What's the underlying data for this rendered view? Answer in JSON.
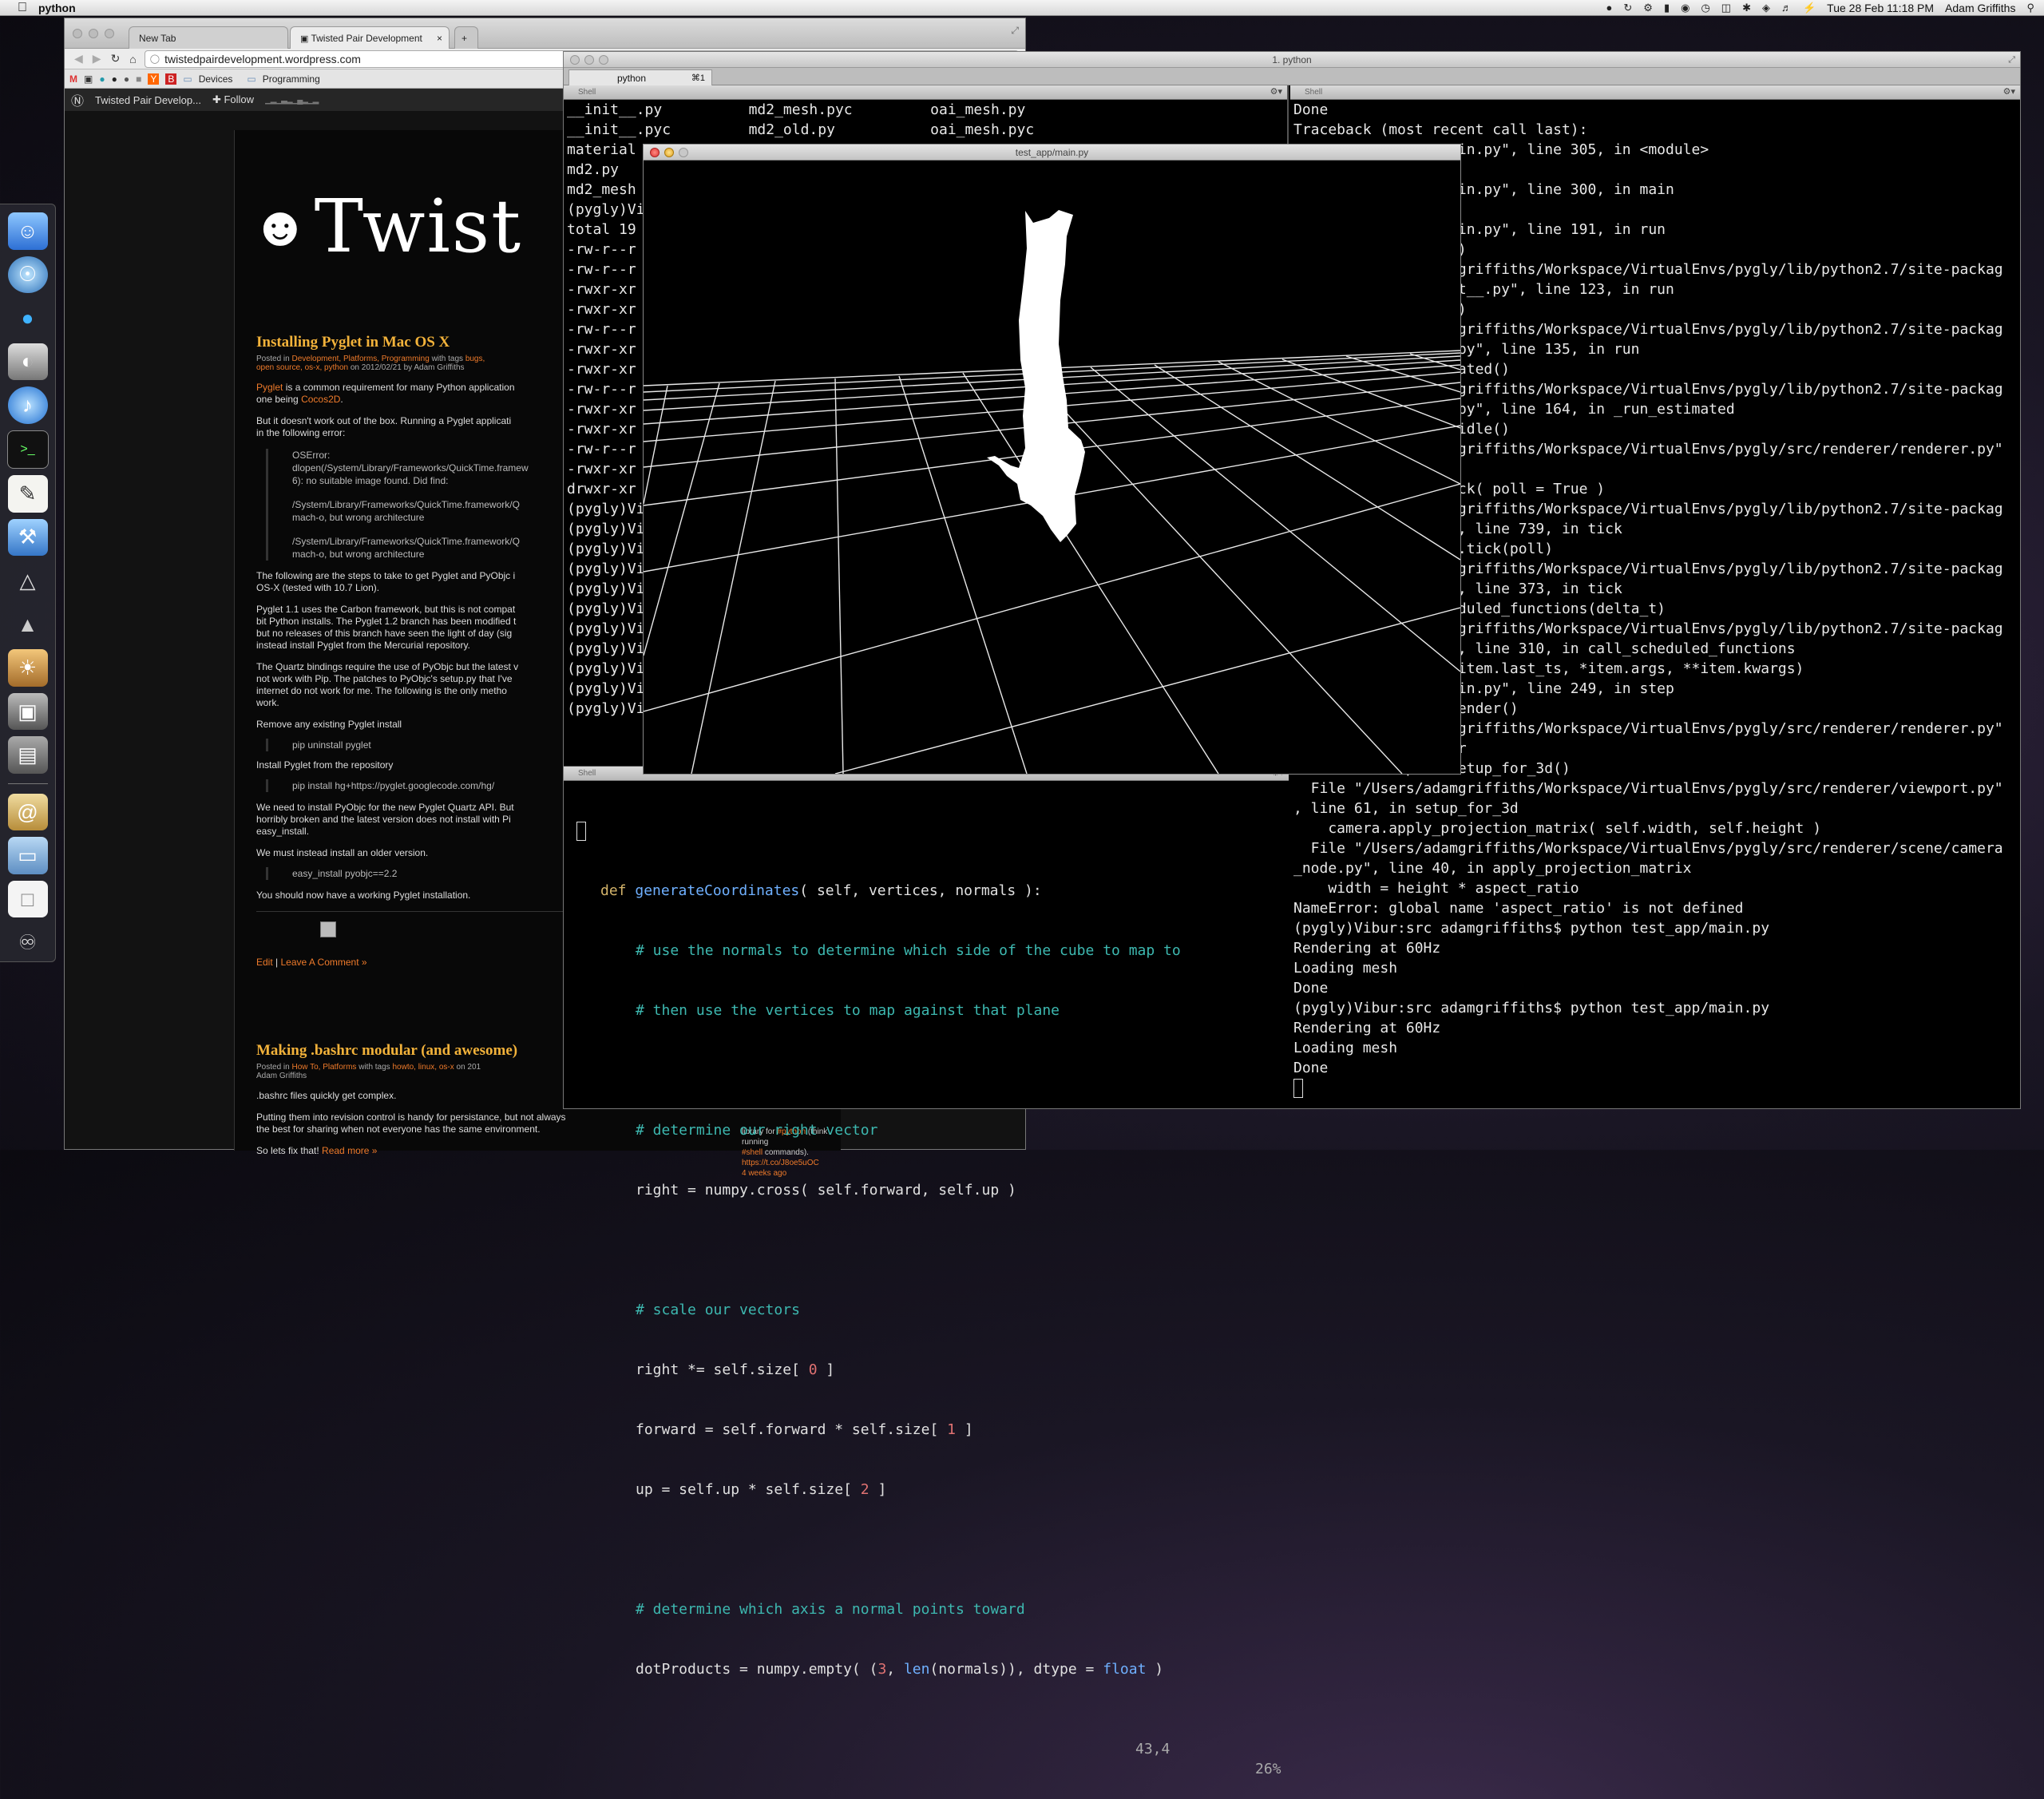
{
  "menubar": {
    "app_name": "python",
    "clock": "Tue 28 Feb  11:18 PM",
    "user": "Adam Griffiths"
  },
  "dock": {
    "icons": [
      "finder-icon",
      "browser-icon",
      "adium-icon",
      "disk-utility-icon",
      "itunes-icon",
      "terminal-icon",
      "textedit-icon",
      "xcode-icon",
      "inkscape-icon",
      "flip-icon",
      "iphoto-icon",
      "preview-icon",
      "console-icon",
      "address-book-icon",
      "folder-icon",
      "document-icon",
      "trash-icon"
    ]
  },
  "browser": {
    "tabs": [
      {
        "label": "New Tab"
      },
      {
        "label": "Twisted Pair Development"
      }
    ],
    "url": "twistedpairdevelopment.wordpress.com",
    "bookmarks": [
      "Devices",
      "Programming"
    ],
    "wp_bar": {
      "site_name": "Twisted Pair Develop...",
      "follow_label": "Follow"
    },
    "blog": {
      "logo_text": "Twist",
      "post1": {
        "title": "Installing Pyglet in Mac OS X",
        "meta_prefix": "Posted in",
        "meta_cats": "Development, Platforms, Programming",
        "meta_mid": "with tags",
        "meta_tags_1": "bugs,",
        "meta_tags_2": "open source, os-x, python",
        "meta_date": "on 2012/02/21 by Adam Griffiths",
        "p1_link": "Pyglet",
        "p1_text": " is a common requirement for many Python application",
        "p1_text2": "one being ",
        "p1_link2": "Cocos2D",
        "p1_end": ".",
        "p2": "But it doesn't work out of the box. Running a Pyglet applicati",
        "p2b": "in the following error:",
        "err1": "OSError:",
        "err2": "dlopen(/System/Library/Frameworks/QuickTime.framew",
        "err3": "6): no suitable image found.  Did find:",
        "err4": "/System/Library/Frameworks/QuickTime.framework/Q",
        "err5": "mach-o, but wrong architecture",
        "err6": "/System/Library/Frameworks/QuickTime.framework/Q",
        "err7": "mach-o, but wrong architecture",
        "p3": "The following are the steps to take to get Pyglet and PyObjc i",
        "p3b": "OS-X (tested with 10.7 Lion).",
        "p4": "Pyglet 1.1 uses the Carbon framework, but this is not compat",
        "p4b": "bit Python installs. The Pyglet 1.2 branch has been modified t",
        "p4c": "but no releases of this branch have seen the light of day (sig",
        "p4d": "instead install Pyglet from the Mercurial repository.",
        "p5": "The Quartz bindings require the use of PyObjc but the latest v",
        "p5b": "not work with Pip. The patches to PyObjc's setup.py that I've",
        "p5c": "internet do not work for me. The following is the only metho",
        "p5d": "work.",
        "p6": "Remove any existing Pyglet install",
        "c1": "pip uninstall pyglet",
        "p7": "Install Pyglet from the repository",
        "c2": "pip install hg+https://pyglet.googlecode.com/hg/",
        "p8": "We need to install PyObjc for the new Pyglet Quartz API. But",
        "p8b": "horribly broken and the latest version does not install with Pi",
        "p8c": "easy_install.",
        "p9": "We must instead install an older version.",
        "c3": "easy_install pyobjc==2.2",
        "p10": "You should now have a working Pyglet installation.",
        "edit": "Edit",
        "sep": " | ",
        "comment": "Leave A Comment »"
      },
      "post2": {
        "title": "Making .bashrc modular (and awesome)",
        "meta_prefix": "Posted in",
        "meta_cats": "How To, Platforms",
        "meta_mid": "with tags",
        "meta_tags": "howto, linux, os-x",
        "meta_date": "on 201",
        "author": "Adam Griffiths",
        "p1": ".bashrc files quickly get complex.",
        "p2": "Putting them into revision control is handy for persistance, but not always",
        "p2b": "the best for sharing when not everyone has the same environment.",
        "p3": "So lets fix that! ",
        "read_more": "Read more »"
      },
      "twitter": {
        "l1": "library for ",
        "l1_tag": "#python",
        "l1_end": " (think running",
        "l2_tag": "#shell",
        "l2_end": " commands).",
        "l3": "https://t.co/J8oe5uOC",
        "l4": "4 weeks ago"
      }
    }
  },
  "terminal": {
    "title": "1. python",
    "tab_label": "python",
    "tab_shortcut": "⌘1",
    "pane_label": "Shell",
    "left_top_lines": [
      "__init__.py          md2_mesh.pyc         oai_mesh.py",
      "__init__.pyc         md2_old.py           oai_mesh.pyc",
      "material",
      "md2.py",
      "md2_mesh",
      "(pygly)Vi",
      "total 19",
      "-rw-r--r",
      "-rw-r--r",
      "-rwxr-xr",
      "-rwxr-xr",
      "-rw-r--r",
      "-rwxr-xr",
      "-rwxr-xr",
      "-rw-r--r",
      "-rwxr-xr",
      "-rwxr-xr",
      "-rw-r--r",
      "-rwxr-xr",
      "drwxr-xr",
      "(pygly)Vi",
      "(pygly)Vi",
      "(pygly)Vi",
      "(pygly)Vi",
      "(pygly)Vi",
      "(pygly)Vi",
      "(pygly)Vi",
      "(pygly)Vi",
      "(pygly)Vi",
      "(pygly)Vi",
      "(pygly)Vi"
    ],
    "right_lines": [
      "Done",
      "Traceback (most recent call last):",
      "                   in.py\", line 305, in <module>",
      "",
      "                   in.py\", line 300, in main",
      "",
      "                   in.py\", line 191, in run",
      "                   )",
      "                   griffiths/Workspace/VirtualEnvs/pygly/lib/python2.7/site-packag",
      "                   t__.py\", line 123, in run",
      "                   )",
      "                   griffiths/Workspace/VirtualEnvs/pygly/lib/python2.7/site-packag",
      "                   py\", line 135, in run",
      "                   ated()",
      "                   griffiths/Workspace/VirtualEnvs/pygly/lib/python2.7/site-packag",
      "                   py\", line 164, in _run_estimated",
      "                   idle()",
      "                   griffiths/Workspace/VirtualEnvs/pygly/src/renderer/renderer.py\"",
      "",
      "                   ck( poll = True )",
      "                   griffiths/Workspace/VirtualEnvs/pygly/lib/python2.7/site-packag",
      "                   , line 739, in tick",
      "                   .tick(poll)",
      "                   griffiths/Workspace/VirtualEnvs/pygly/lib/python2.7/site-packag",
      "                   , line 373, in tick",
      "                   duled_functions(delta_t)",
      "                   griffiths/Workspace/VirtualEnvs/pygly/lib/python2.7/site-packag",
      "                   , line 310, in call_scheduled_functions",
      "                   item.last_ts, *item.args, **item.kwargs)",
      "                   in.py\", line 249, in step",
      "                   ender()",
      "                   griffiths/Workspace/VirtualEnvs/pygly/src/renderer/renderer.py\"",
      "                   r",
      "    self.viewport.setup_for_3d()",
      "  File \"/Users/adamgriffiths/Workspace/VirtualEnvs/pygly/src/renderer/viewport.py\"",
      ", line 61, in setup_for_3d",
      "    camera.apply_projection_matrix( self.width, self.height )",
      "  File \"/Users/adamgriffiths/Workspace/VirtualEnvs/pygly/src/renderer/scene/camera",
      "_node.py\", line 40, in apply_projection_matrix",
      "    width = height * aspect_ratio",
      "NameError: global name 'aspect_ratio' is not defined",
      "(pygly)Vibur:src adamgriffiths$ python test_app/main.py",
      "Rendering at 60Hz",
      "Loading mesh",
      "Done",
      "(pygly)Vibur:src adamgriffiths$ python test_app/main.py",
      "Rendering at 60Hz",
      "Loading mesh",
      "Done"
    ],
    "editor": {
      "l1_kw": "def",
      "l1_fn": "generateCoordinates",
      "l1_rest": "( self, vertices, normals ):",
      "l2": "# use the normals to determine which side of the cube to map to",
      "l3": "# then use the vertices to map against that plane",
      "l4": "# determine our right vector",
      "l5": "right = numpy.cross( self.forward, self.up )",
      "l6": "# scale our vectors",
      "l7a": "right *= self.size[ ",
      "l7n": "0",
      "l7b": " ]",
      "l8a": "forward = self.forward * self.size[ ",
      "l8n": "1",
      "l8b": " ]",
      "l9a": "up = self.up * self.size[ ",
      "l9n": "2",
      "l9b": " ]",
      "l10": "# determine which axis a normal points toward",
      "l11a": "dotProducts = numpy.empty( (",
      "l11n": "3",
      "l11b": ", ",
      "l11fn": "len",
      "l11c": "(normals)), dtype = ",
      "l11kw": "float",
      "l11d": " )",
      "status_pos": "43,4",
      "status_pct": "26%"
    }
  },
  "gl_window": {
    "title": "test_app/main.py"
  }
}
